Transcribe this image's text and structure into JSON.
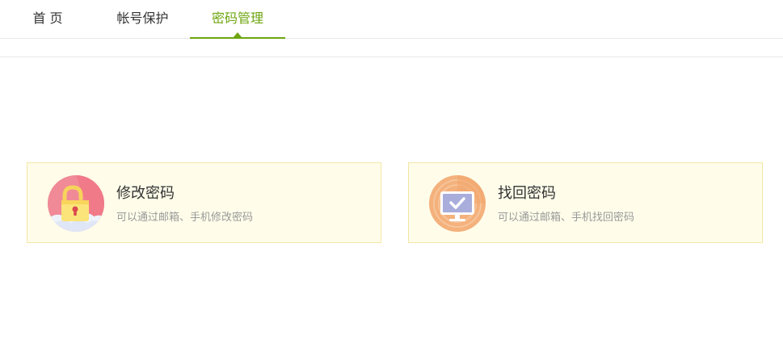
{
  "nav": {
    "tabs": [
      {
        "label": "首 页"
      },
      {
        "label": "帐号保护"
      },
      {
        "label": "密码管理"
      }
    ],
    "active_index": 2,
    "accent_color": "#6ea50f"
  },
  "cards": [
    {
      "title": "修改密码",
      "desc": "可以通过邮箱、手机修改密码",
      "icon": "unlock-padlock-icon"
    },
    {
      "title": "找回密码",
      "desc": "可以通过邮箱、手机找回密码",
      "icon": "monitor-check-icon"
    }
  ]
}
